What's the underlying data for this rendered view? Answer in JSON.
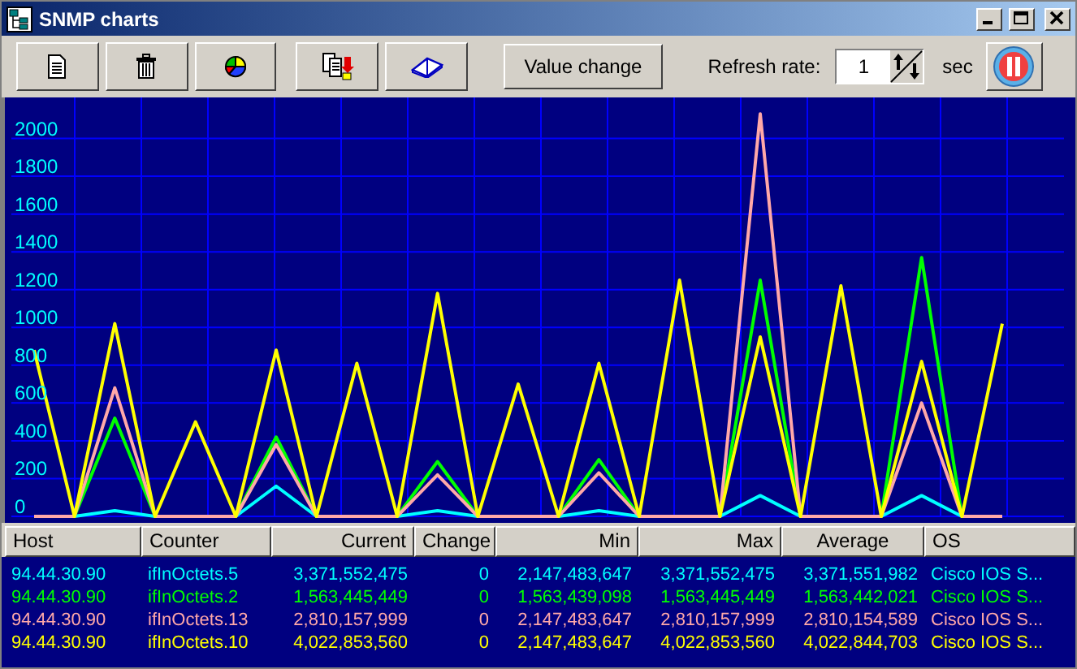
{
  "window": {
    "title": "SNMP charts"
  },
  "toolbar": {
    "value_change": "Value change",
    "refresh_label": "Refresh rate:",
    "refresh_value": "1",
    "refresh_unit": "sec"
  },
  "chart": {
    "chart_data": {
      "type": "line",
      "grid": true,
      "ylim": [
        0,
        2200
      ],
      "yticks": [
        2000,
        1800,
        1600,
        1400,
        1200,
        1000,
        800,
        600,
        400,
        200,
        0
      ],
      "series": [
        {
          "color": "#00ffff",
          "values": [
            0,
            0,
            30,
            0,
            0,
            0,
            160,
            0,
            0,
            0,
            30,
            0,
            0,
            0,
            30,
            0,
            0,
            0,
            110,
            0,
            0,
            0,
            110,
            0,
            0
          ]
        },
        {
          "color": "#00ff00",
          "values": [
            0,
            0,
            520,
            0,
            0,
            0,
            420,
            0,
            0,
            0,
            290,
            0,
            0,
            0,
            300,
            0,
            0,
            0,
            1250,
            0,
            0,
            0,
            1370,
            0,
            0
          ]
        },
        {
          "color": "#ffa8a8",
          "values": [
            0,
            0,
            680,
            0,
            0,
            0,
            380,
            0,
            0,
            0,
            220,
            0,
            0,
            0,
            230,
            0,
            0,
            0,
            2130,
            0,
            0,
            0,
            600,
            0,
            0
          ]
        },
        {
          "color": "#ffff00",
          "values": [
            880,
            0,
            1020,
            0,
            500,
            0,
            880,
            0,
            810,
            0,
            1180,
            0,
            700,
            0,
            810,
            0,
            1250,
            0,
            950,
            0,
            1220,
            0,
            820,
            0,
            1020
          ]
        }
      ]
    }
  },
  "table": {
    "columns": [
      "Host",
      "Counter",
      "Current",
      "Change",
      "Min",
      "Max",
      "Average",
      "OS"
    ],
    "rows": [
      {
        "color": "#00ffff",
        "cells": [
          "94.44.30.90",
          "ifInOctets.5",
          "3,371,552,475",
          "0",
          "2,147,483,647",
          "3,371,552,475",
          "3,371,551,982",
          "Cisco IOS S..."
        ]
      },
      {
        "color": "#00ff00",
        "cells": [
          "94.44.30.90",
          "ifInOctets.2",
          "1,563,445,449",
          "0",
          "1,563,439,098",
          "1,563,445,449",
          "1,563,442,021",
          "Cisco IOS S..."
        ]
      },
      {
        "color": "#ffa8a8",
        "cells": [
          "94.44.30.90",
          "ifInOctets.13",
          "2,810,157,999",
          "0",
          "2,147,483,647",
          "2,810,157,999",
          "2,810,154,589",
          "Cisco IOS S..."
        ]
      },
      {
        "color": "#ffff00",
        "cells": [
          "94.44.30.90",
          "ifInOctets.10",
          "4,022,853,560",
          "0",
          "2,147,483,647",
          "4,022,853,560",
          "4,022,844,703",
          "Cisco IOS S..."
        ]
      }
    ]
  }
}
